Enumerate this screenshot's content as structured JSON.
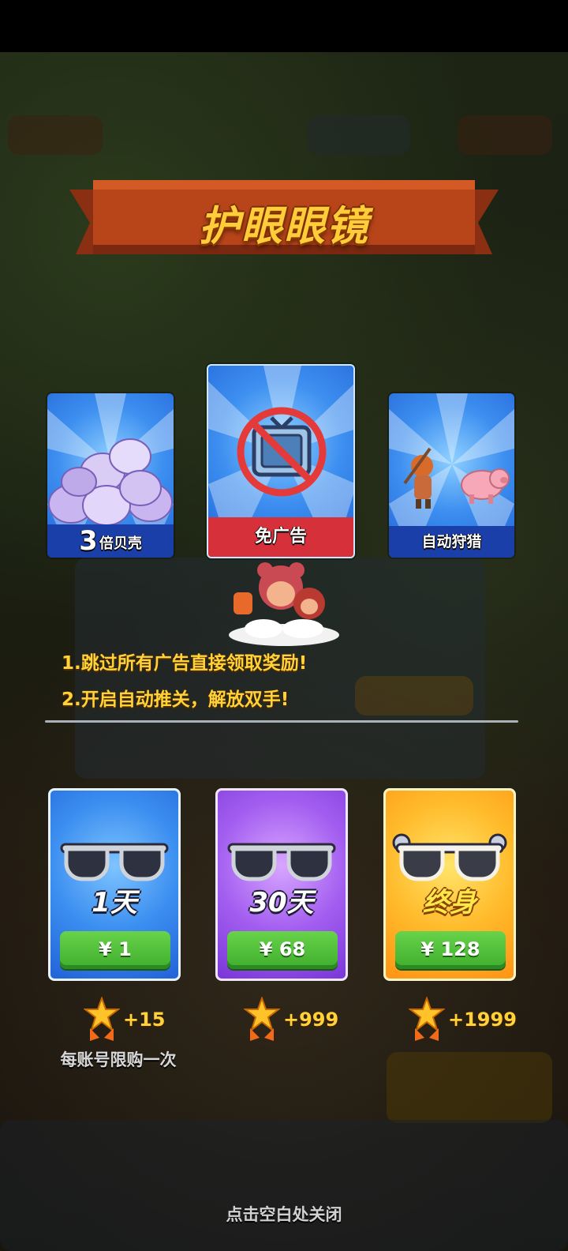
{
  "title": "护眼眼镜",
  "features": [
    {
      "number": "3",
      "label": "倍贝壳"
    },
    {
      "label": "免广告"
    },
    {
      "label": "自动狩猎"
    }
  ],
  "info_lines": [
    "1.跳过所有广告直接领取奖励!",
    "2.开启自动推关，解放双手!"
  ],
  "plans": [
    {
      "duration": "1天",
      "price": "¥ 1",
      "reward": "+15",
      "color": "#3b8ef0"
    },
    {
      "duration": "30天",
      "price": "¥ 68",
      "reward": "+999",
      "color": "#a35ef0"
    },
    {
      "duration": "终身",
      "price": "¥ 128",
      "reward": "+1999",
      "color": "#ffba2a"
    }
  ],
  "limit_note": "每账号限购一次",
  "close_hint": "点击空白处关闭",
  "icons": {
    "feature1": "seashell-pile-icon",
    "feature2": "no-tv-ads-icon",
    "feature3": "hunter-and-pig-icon",
    "plan": "sunglasses-icon",
    "reward": "star-badge-icon"
  }
}
